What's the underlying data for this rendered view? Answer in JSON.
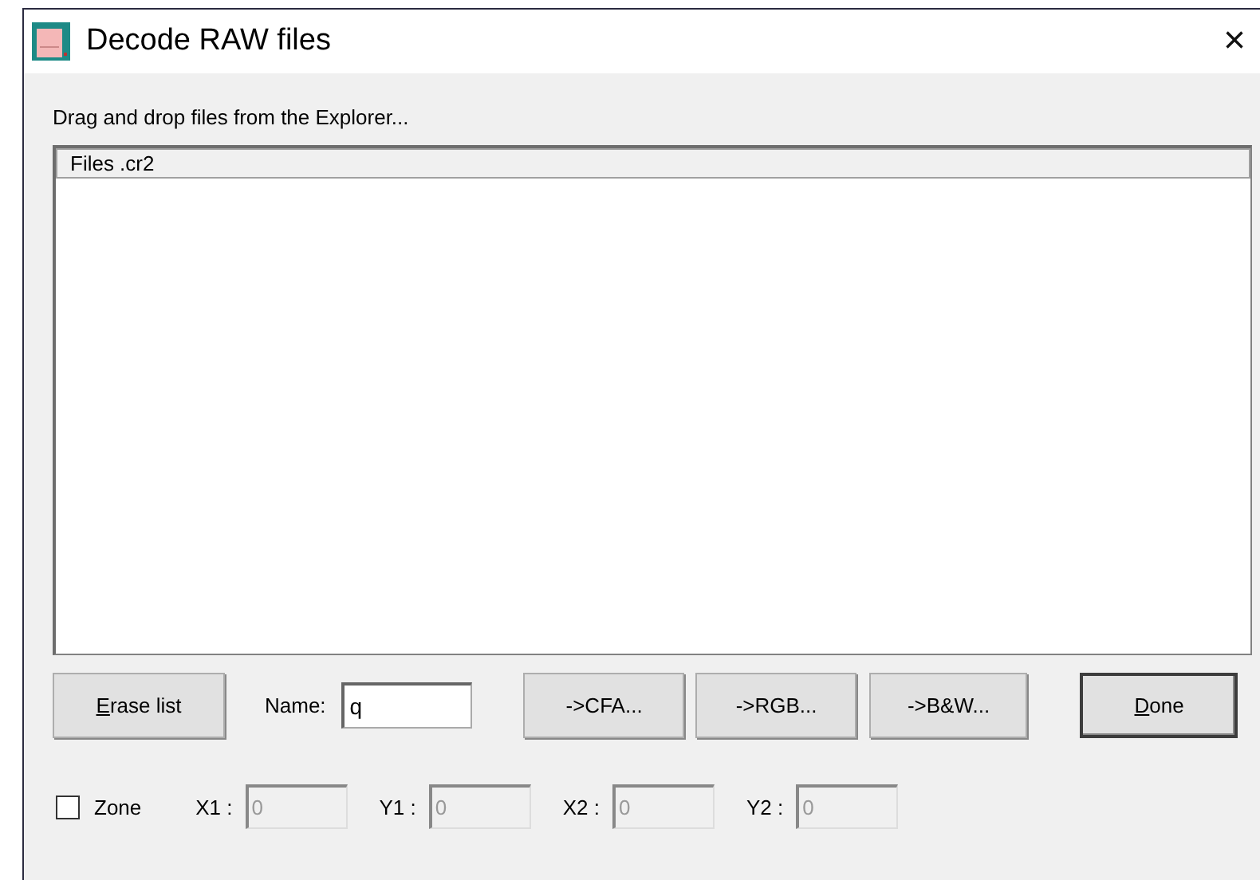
{
  "window": {
    "title": "Decode RAW files",
    "close": "×"
  },
  "instructions": "Drag and drop files from the Explorer...",
  "file_list": {
    "columns": [
      "Files .cr2"
    ]
  },
  "buttons": [
    {
      "label": "Erase list",
      "mnemonic": true,
      "default": false
    },
    {
      "kind": "field",
      "label": "Name:",
      "value": "q"
    },
    {
      "label": "->CFA...",
      "mnemonic": false,
      "default": false
    },
    {
      "label": "->RGB...",
      "mnemonic": false,
      "default": false
    },
    {
      "label": "->B&W...",
      "mnemonic": false,
      "default": false
    },
    {
      "label": "Done",
      "mnemonic": true,
      "default": true
    }
  ],
  "zone": {
    "label": "Zone",
    "checked": false
  },
  "coordinates": [
    {
      "label": "X1 :",
      "value": "0",
      "disabled": true
    },
    {
      "label": "Y1 :",
      "value": "0",
      "disabled": true
    },
    {
      "label": "X2 :",
      "value": "0",
      "disabled": true
    },
    {
      "label": "Y2 :",
      "value": "0",
      "disabled": true
    }
  ]
}
